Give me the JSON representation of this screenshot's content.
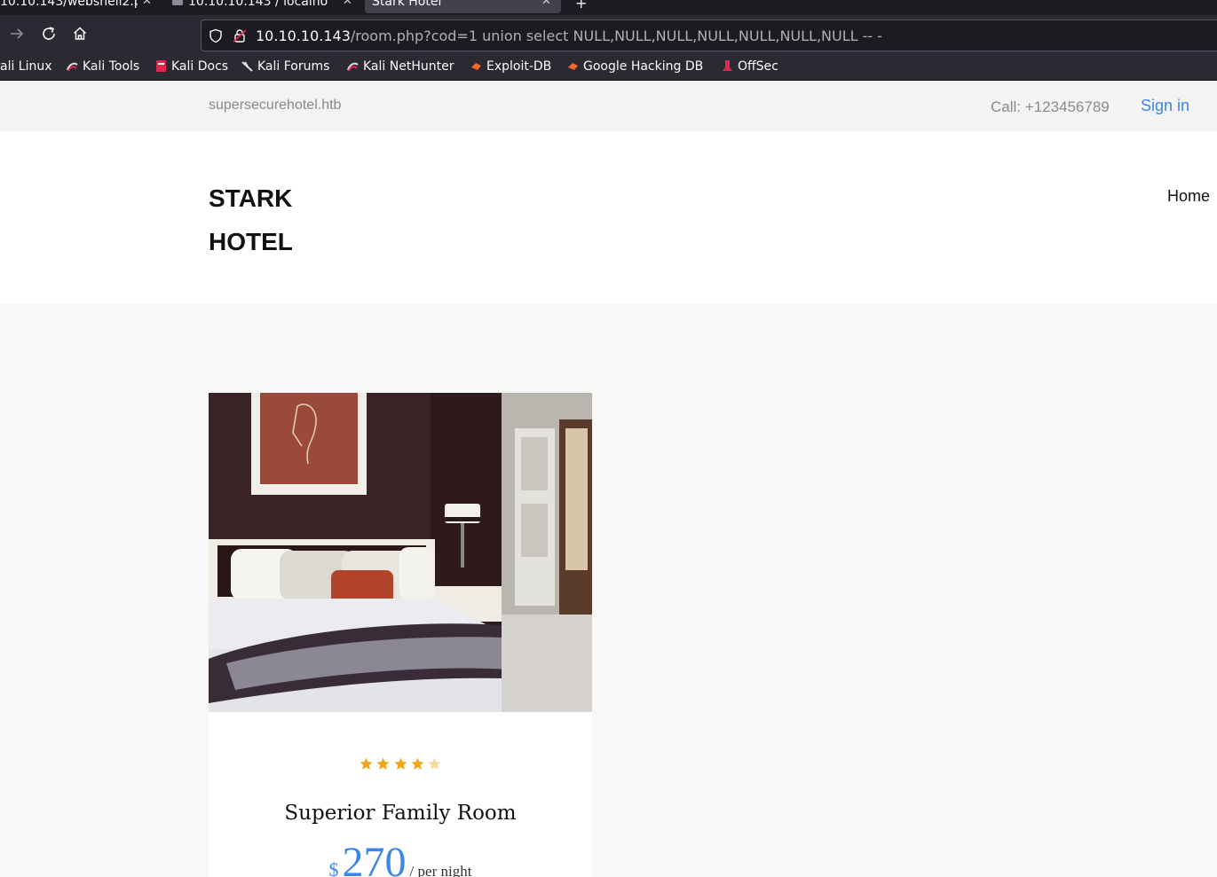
{
  "browser": {
    "tabs": [
      {
        "title": "10.10.143/webshell2.p",
        "active": false
      },
      {
        "title": "10.10.10.143 / localho",
        "active": false
      },
      {
        "title": "Stark Hotel",
        "active": true
      }
    ],
    "new_tab_label": "+",
    "url_host": "10.10.10.143",
    "url_rest": "/room.php?cod=1 union select NULL,NULL,NULL,NULL,NULL,NULL,NULL -- -",
    "nav_icons": [
      "forward-icon",
      "reload-icon",
      "home-icon"
    ],
    "bookmarks": [
      {
        "label": "ali Linux",
        "icon": "none"
      },
      {
        "label": "Kali Tools",
        "icon": "kali-icon"
      },
      {
        "label": "Kali Docs",
        "icon": "kali-docs-icon"
      },
      {
        "label": "Kali Forums",
        "icon": "kali-forums-icon"
      },
      {
        "label": "Kali NetHunter",
        "icon": "kali-icon"
      },
      {
        "label": "Exploit-DB",
        "icon": "exploitdb-icon"
      },
      {
        "label": "Google Hacking DB",
        "icon": "exploitdb-icon"
      },
      {
        "label": "OffSec",
        "icon": "offsec-icon"
      }
    ]
  },
  "site": {
    "domain": "supersecurehotel.htb",
    "call": "Call: +123456789",
    "signin": "Sign in",
    "logo_line1": "STARK",
    "logo_line2": "HOTEL",
    "nav_home": "Home",
    "accent_color": "#3b86e6",
    "room": {
      "rating": 4,
      "rating_max": 5,
      "name": "Superior Family Room",
      "currency": "$",
      "price": "270",
      "per": "/ per night"
    }
  }
}
